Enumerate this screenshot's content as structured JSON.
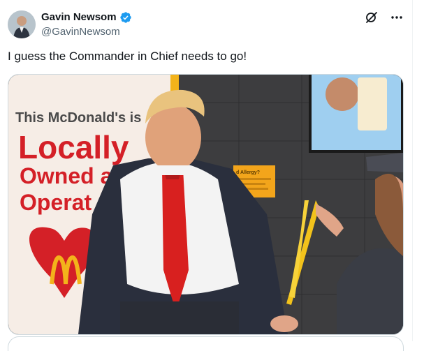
{
  "author": {
    "display_name": "Gavin Newsom",
    "handle": "@GavinNewsom",
    "verified": true
  },
  "tweet": {
    "text": "I guess the Commander in Chief needs to go!"
  },
  "media_sign": {
    "line1": "This McDonald's is",
    "line2": "Locally",
    "line3": "Owned a",
    "line4": "Operat",
    "allergy_label": "d Allergy?"
  },
  "icons": {
    "verified": "verified-badge-icon",
    "grok": "grok-icon",
    "more": "more-options-icon"
  },
  "colors": {
    "accent": "#1d9bf0",
    "text": "#0f1419",
    "secondary": "#536471",
    "border": "#cfd9de",
    "sign_red": "#d42027"
  }
}
